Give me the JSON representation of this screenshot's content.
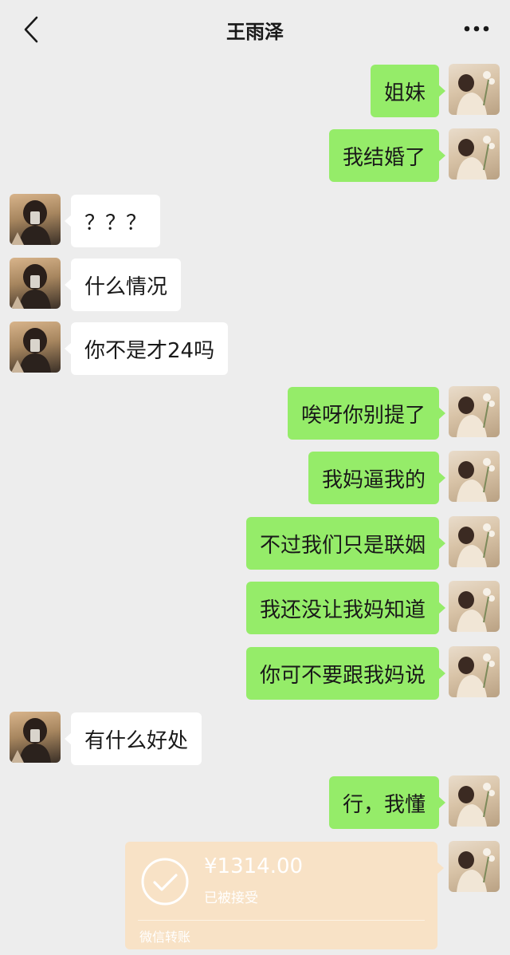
{
  "header": {
    "title": "王雨泽",
    "back_icon": "chevron-left-icon",
    "more_icon": "more-dots-icon"
  },
  "messages": [
    {
      "from": "me",
      "text": "姐妹"
    },
    {
      "from": "me",
      "text": "我结婚了"
    },
    {
      "from": "other",
      "text": "？？？"
    },
    {
      "from": "other",
      "text": "什么情况"
    },
    {
      "from": "other",
      "text": "你不是才24吗"
    },
    {
      "from": "me",
      "text": "唉呀你别提了"
    },
    {
      "from": "me",
      "text": "我妈逼我的"
    },
    {
      "from": "me",
      "text": "不过我们只是联姻"
    },
    {
      "from": "me",
      "text": "我还没让我妈知道"
    },
    {
      "from": "me",
      "text": "你可不要跟我妈说"
    },
    {
      "from": "other",
      "text": "有什么好处"
    },
    {
      "from": "me",
      "text": "行，我懂"
    }
  ],
  "transfer": {
    "amount": "¥1314.00",
    "status": "已被接受",
    "footer": "微信转账",
    "icon": "check-circle-icon"
  },
  "colors": {
    "background": "#ededed",
    "my_bubble": "#95ec69",
    "other_bubble": "#ffffff",
    "transfer_card": "#f8e2c6"
  }
}
